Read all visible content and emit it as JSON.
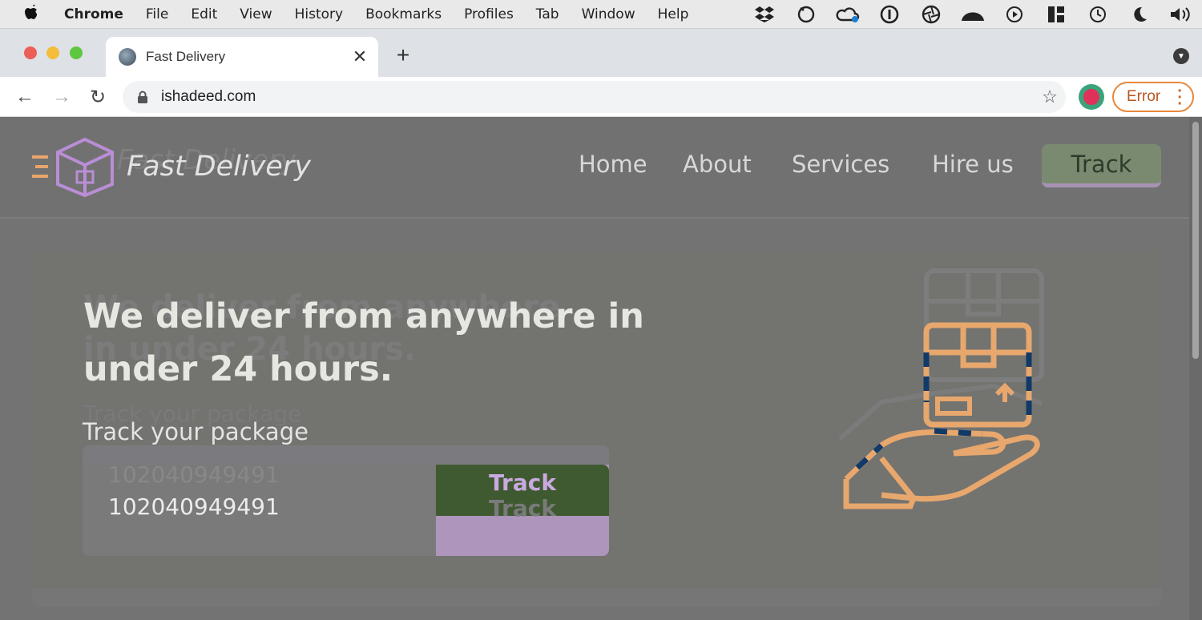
{
  "menubar": {
    "apple": "",
    "items": [
      "Chrome",
      "File",
      "Edit",
      "View",
      "History",
      "Bookmarks",
      "Profiles",
      "Tab",
      "Window",
      "Help"
    ],
    "tray_icons": [
      "dropbox-icon",
      "cloud-sync-icon",
      "creative-cloud-icon",
      "1password-icon",
      "aperture-icon",
      "messenger-icon",
      "play-icon",
      "magnet-icon",
      "time-machine-icon",
      "night-shift-icon",
      "volume-icon"
    ]
  },
  "tabs": [
    {
      "title": "Fast Delivery",
      "close": "✕"
    }
  ],
  "new_tab": "+",
  "toolbar": {
    "back": "←",
    "forward": "→",
    "reload": "↻",
    "url": "ishadeed.com",
    "star": "☆",
    "error_label": "Error"
  },
  "site": {
    "brand": "Fast Delivery",
    "nav": {
      "home": "Home",
      "about": "About",
      "services": "Services",
      "hire": "Hire us",
      "track": "Track"
    },
    "hero": {
      "heading": "We deliver from anywhere in under 24 hours.",
      "track_label": "Track your package",
      "input_value": "102040949491",
      "submit_label": "Track"
    }
  },
  "colors": {
    "accent_green": "#3f5a31",
    "accent_purple": "#ad95bb",
    "error_orange": "#e8873a",
    "illustration_orange": "#e7a76d",
    "illustration_navy": "#123a68"
  }
}
